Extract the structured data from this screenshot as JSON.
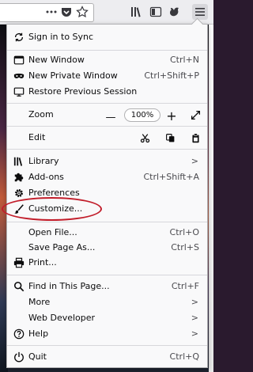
{
  "toolbar": {
    "icons": [
      "more-dots-icon",
      "pocket-icon",
      "bookmark-star-icon",
      "library-icon",
      "sidebar-icon",
      "firefox-account-icon",
      "hamburger-menu-icon"
    ]
  },
  "menu": {
    "sync": {
      "label": "Sign in to Sync",
      "icon": "sync-icon"
    },
    "new_window": {
      "label": "New Window",
      "shortcut": "Ctrl+N",
      "icon": "window-icon"
    },
    "new_private": {
      "label": "New Private Window",
      "shortcut": "Ctrl+Shift+P",
      "icon": "private-mask-icon"
    },
    "restore": {
      "label": "Restore Previous Session",
      "icon": "restore-icon"
    },
    "zoom": {
      "label": "Zoom",
      "minus": "—",
      "value": "100%",
      "plus": "+",
      "fullscreen_icon": "fullscreen-icon"
    },
    "edit": {
      "label": "Edit",
      "icons": [
        "cut-icon",
        "copy-icon",
        "paste-icon"
      ]
    },
    "library": {
      "label": "Library",
      "chev": ">",
      "icon": "library-icon"
    },
    "addons": {
      "label": "Add-ons",
      "shortcut": "Ctrl+Shift+A",
      "icon": "puzzle-icon"
    },
    "preferences": {
      "label": "Preferences",
      "icon": "gear-icon"
    },
    "customize": {
      "label": "Customize...",
      "icon": "paintbrush-icon"
    },
    "open_file": {
      "label": "Open File...",
      "shortcut": "Ctrl+O"
    },
    "save_page": {
      "label": "Save Page As...",
      "shortcut": "Ctrl+S"
    },
    "print": {
      "label": "Print...",
      "icon": "printer-icon"
    },
    "find": {
      "label": "Find in This Page...",
      "shortcut": "Ctrl+F",
      "icon": "search-icon"
    },
    "more": {
      "label": "More",
      "chev": ">"
    },
    "web_dev": {
      "label": "Web Developer",
      "chev": ">"
    },
    "help": {
      "label": "Help",
      "chev": ">",
      "icon": "help-icon"
    },
    "quit": {
      "label": "Quit",
      "shortcut": "Ctrl+Q",
      "icon": "power-icon"
    }
  },
  "annotation": {
    "highlight_color": "#c21d2a"
  }
}
